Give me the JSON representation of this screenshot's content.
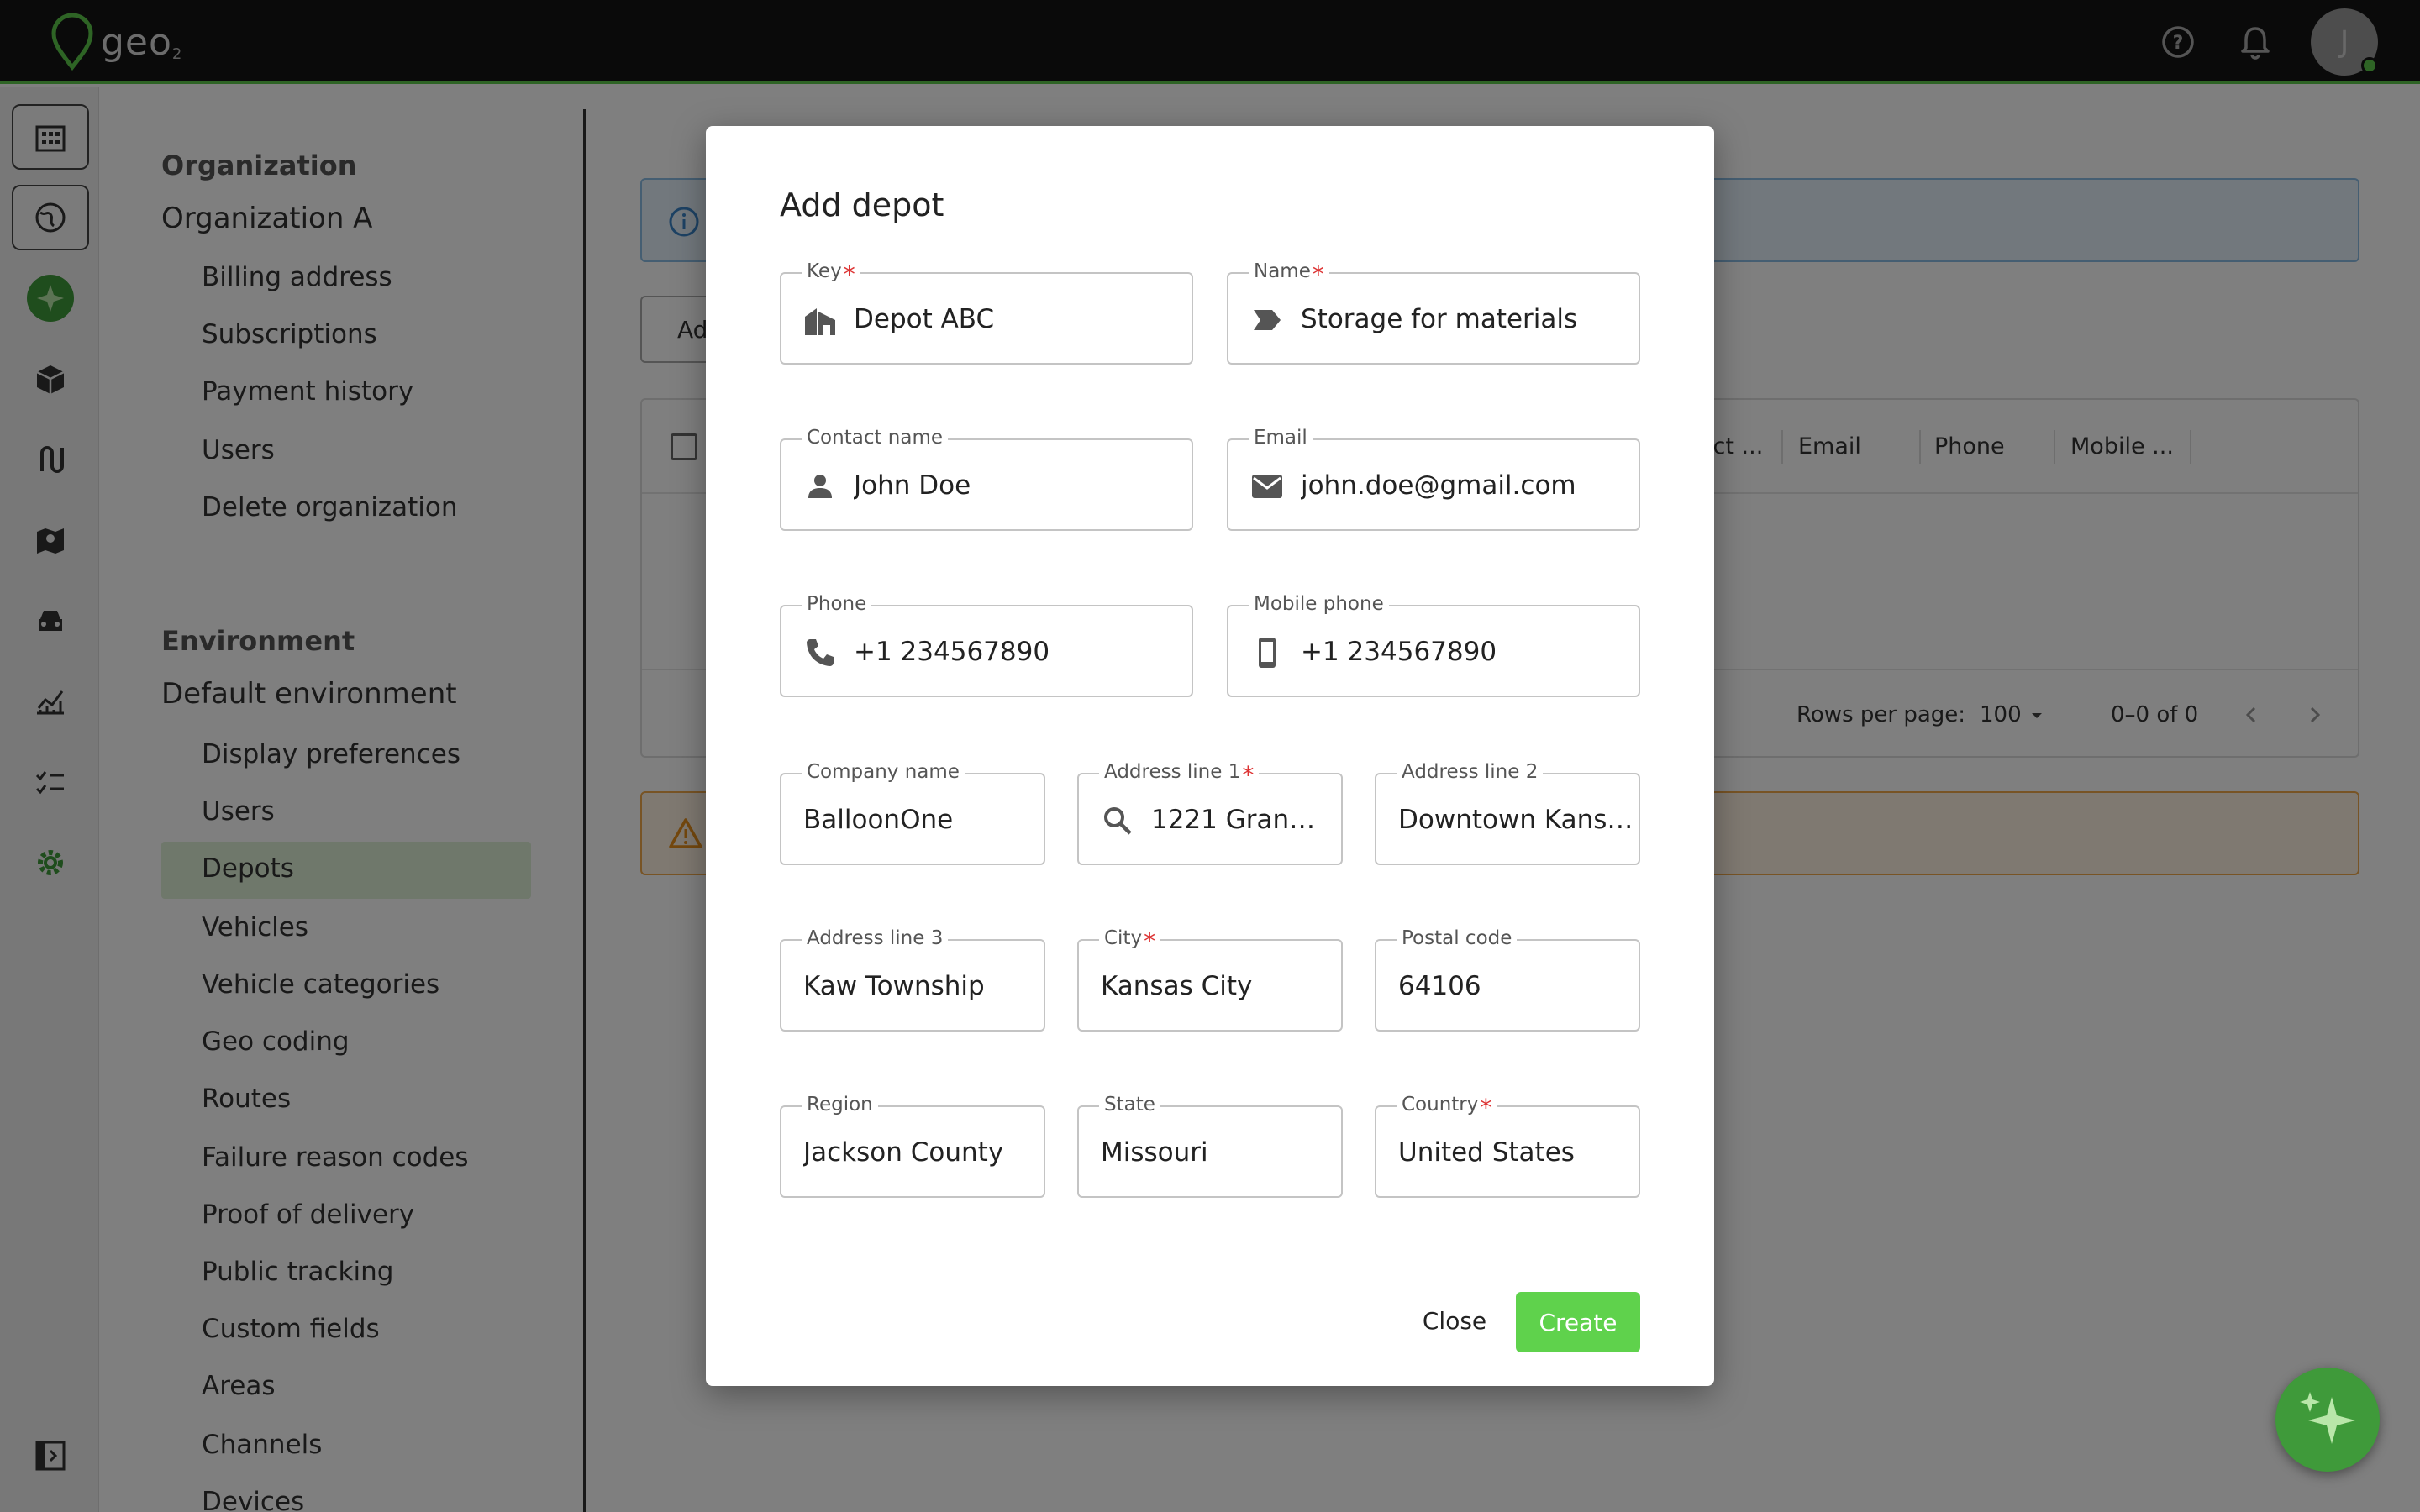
{
  "app": {
    "logo_text": "geo",
    "logo_sub": "2"
  },
  "header": {
    "avatar_initial": "J"
  },
  "settings_nav": {
    "org_section": "Organization",
    "org_name": "Organization A",
    "org_items": [
      "Billing address",
      "Subscriptions",
      "Payment history",
      "Users",
      "Delete organization"
    ],
    "env_section": "Environment",
    "env_name": "Default environment",
    "env_items": [
      "Display preferences",
      "Users",
      "Depots",
      "Vehicles",
      "Vehicle categories",
      "Geo coding",
      "Routes",
      "Failure reason codes",
      "Proof of delivery",
      "Public tracking",
      "Custom fields",
      "Areas",
      "Channels",
      "Devices"
    ],
    "active_item": "Depots"
  },
  "background": {
    "add_button_label": "Ad",
    "grid_columns": [
      "act ...",
      "Email",
      "Phone",
      "Mobile ..."
    ],
    "rows_per_page_label": "Rows per page:",
    "rows_per_page_value": "100",
    "pagination": "0–0 of 0"
  },
  "modal": {
    "title": "Add depot",
    "fields": {
      "key": {
        "label": "Key",
        "value": "Depot ABC",
        "required": true
      },
      "name": {
        "label": "Name",
        "value": "Storage for materials",
        "required": true
      },
      "contact_name": {
        "label": "Contact name",
        "value": "John Doe"
      },
      "email": {
        "label": "Email",
        "value": "john.doe@gmail.com"
      },
      "phone": {
        "label": "Phone",
        "value": "+1 234567890"
      },
      "mobile_phone": {
        "label": "Mobile phone",
        "value": "+1 234567890"
      },
      "company_name": {
        "label": "Company name",
        "value": "BalloonOne"
      },
      "address_line_1": {
        "label": "Address line 1",
        "value": "1221 Grand ...",
        "required": true
      },
      "address_line_2": {
        "label": "Address line 2",
        "value": "Downtown Kansas"
      },
      "address_line_3": {
        "label": "Address line 3",
        "value": "Kaw Township"
      },
      "city": {
        "label": "City",
        "value": "Kansas City",
        "required": true
      },
      "postal_code": {
        "label": "Postal code",
        "value": "64106"
      },
      "region": {
        "label": "Region",
        "value": "Jackson County"
      },
      "state": {
        "label": "State",
        "value": "Missouri"
      },
      "country": {
        "label": "Country",
        "value": "United States",
        "required": true
      }
    },
    "required_marker": "*",
    "close_label": "Close",
    "create_label": "Create"
  },
  "colors": {
    "accent": "#5fd24c",
    "topbar": "#151515",
    "required": "#d33333"
  }
}
